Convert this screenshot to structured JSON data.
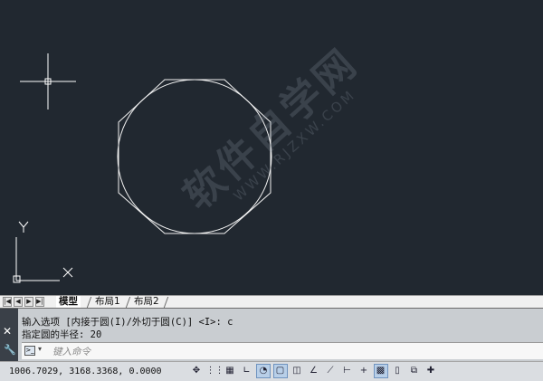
{
  "drawing": {
    "ucs_x_label": "X",
    "ucs_y_label": "Y",
    "watermark_main": "软件自学网",
    "watermark_sub": "WWW.RJZXW.COM"
  },
  "layout_tabs": {
    "nav_first": "|◀",
    "nav_prev": "◀",
    "nav_next": "▶",
    "nav_last": "▶|",
    "items": [
      {
        "label": "模型"
      },
      {
        "label": "布局1"
      },
      {
        "label": "布局2"
      }
    ]
  },
  "command": {
    "history": [
      "输入选项 [内接于圆(I)/外切于圆(C)] <I>: c",
      "指定圆的半径: 20"
    ],
    "placeholder": "键入命令",
    "close_glyph": "✕",
    "settings_glyph": "🔧",
    "prompt_glyph": ">_",
    "caret_glyph": "▾"
  },
  "status_bar": {
    "coordinates": "1006.7029,  3168.3368,  0.0000",
    "buttons": [
      {
        "icon": "model-space-icon",
        "glyph": "✥",
        "on": false
      },
      {
        "icon": "grid-display-icon",
        "glyph": "⋮⋮",
        "on": false
      },
      {
        "icon": "snap-mode-icon",
        "glyph": "▦",
        "on": false
      },
      {
        "icon": "ortho-mode-icon",
        "glyph": "∟",
        "on": false
      },
      {
        "icon": "polar-tracking-icon",
        "glyph": "◔",
        "on": true
      },
      {
        "icon": "object-snap-icon",
        "glyph": "▢",
        "on": true
      },
      {
        "icon": "3d-object-snap-icon",
        "glyph": "◫",
        "on": false
      },
      {
        "icon": "object-snap-tracking-icon",
        "glyph": "∠",
        "on": false
      },
      {
        "icon": "dynamic-ucs-icon",
        "glyph": "⟋",
        "on": false
      },
      {
        "icon": "dynamic-input-icon",
        "glyph": "⊢",
        "on": false
      },
      {
        "icon": "lineweight-icon",
        "glyph": "+",
        "on": false
      },
      {
        "icon": "transparency-icon",
        "glyph": "▩",
        "on": true
      },
      {
        "icon": "quick-properties-icon",
        "glyph": "▯",
        "on": false
      },
      {
        "icon": "selection-cycling-icon",
        "glyph": "⧉",
        "on": false
      },
      {
        "icon": "annotation-monitor-icon",
        "glyph": "✚",
        "on": false
      }
    ]
  }
}
